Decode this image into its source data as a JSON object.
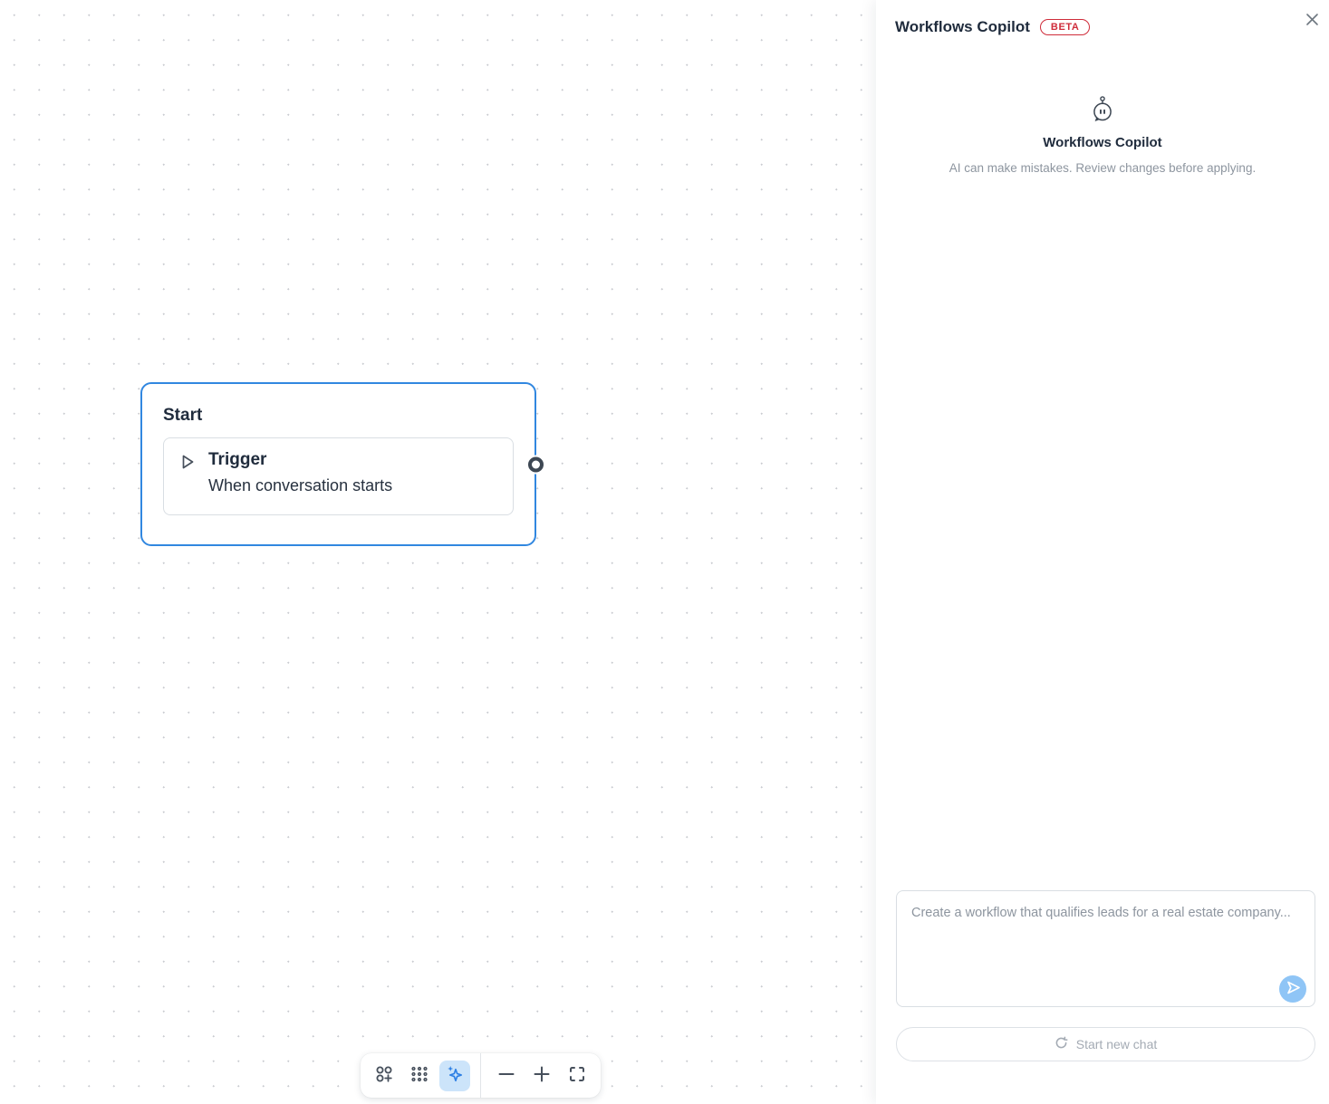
{
  "canvas": {
    "start_node": {
      "title": "Start",
      "trigger": {
        "label": "Trigger",
        "description": "When conversation starts"
      }
    },
    "toolbar": {
      "buttons": [
        "add-node",
        "grid-view",
        "ai-assistant",
        "zoom-out",
        "zoom-in",
        "fit-view"
      ],
      "active_button": "ai-assistant"
    }
  },
  "copilot": {
    "header": {
      "title": "Workflows Copilot",
      "badge": "BETA"
    },
    "empty_state": {
      "icon": "bot-chat-bubble-icon",
      "title": "Workflows Copilot",
      "caption": "AI can make mistakes. Review changes before applying."
    },
    "composer": {
      "placeholder": "Create a workflow that qualifies leads for a real estate company...",
      "value": "",
      "send_icon": "paper-plane-icon"
    },
    "new_chat_label": "Start new chat"
  },
  "colors": {
    "node_border_blue": "#3187E0",
    "ai_icon_blue": "#2F80E4",
    "ai_button_bg": "#CCE4FA",
    "send_button_blue": "#8FC5F6",
    "beta_red": "#CF2C3A",
    "icon_slate": "#47505C",
    "text_dark": "#1F2B3C",
    "text_gray": "#8D959F",
    "border_gray": "#D9DEE3"
  }
}
